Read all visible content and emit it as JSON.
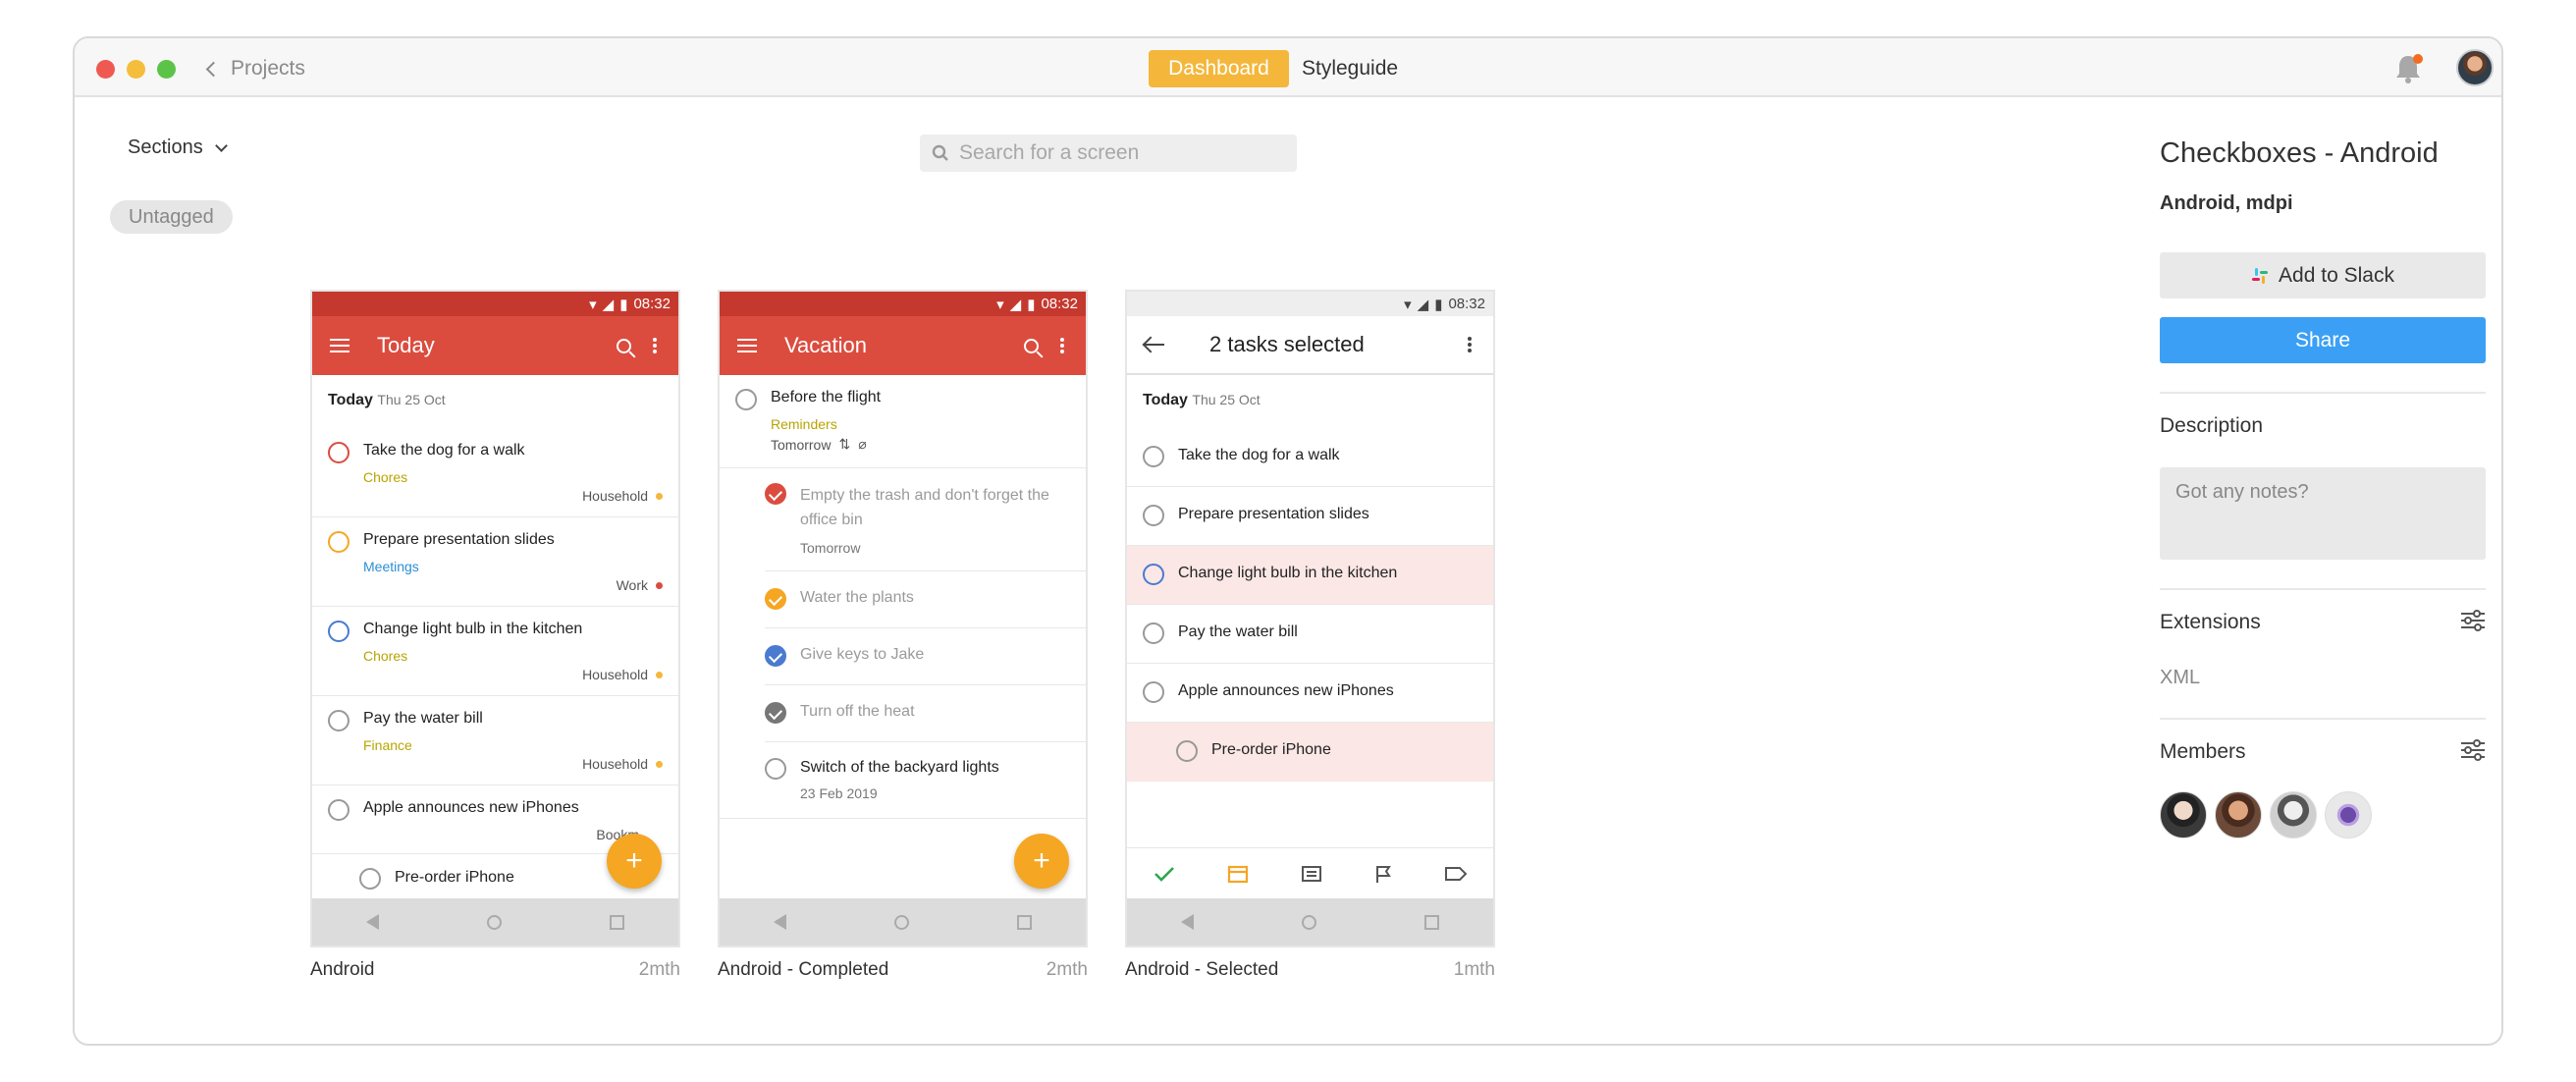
{
  "titlebar": {
    "back_label": "Projects",
    "tabs": [
      "Dashboard",
      "Styleguide"
    ],
    "active_tab": "Dashboard"
  },
  "toolbar": {
    "sections_label": "Sections",
    "untagged_label": "Untagged",
    "search_placeholder": "Search for a screen"
  },
  "screens": [
    {
      "caption": "Android",
      "time": "2mth",
      "status_time": "08:32",
      "title": "Today",
      "day": "Today",
      "date": "Thu 25 Oct",
      "tasks": [
        {
          "title": "Take the dog for a walk",
          "label": "Chores",
          "project": "Household"
        },
        {
          "title": "Prepare presentation slides",
          "label": "Meetings",
          "project": "Work"
        },
        {
          "title": "Change light bulb in the kitchen",
          "label": "Chores",
          "project": "Household"
        },
        {
          "title": "Pay the water bill",
          "label": "Finance",
          "project": "Household"
        },
        {
          "title": "Apple announces new iPhones",
          "label": "",
          "project": "Bookm"
        },
        {
          "title": "Pre-order iPhone",
          "label": "",
          "project": ""
        }
      ],
      "fab": "+"
    },
    {
      "caption": "Android - Completed",
      "time": "2mth",
      "status_time": "08:32",
      "title": "Vacation",
      "tasks": [
        {
          "title": "Before the flight",
          "label": "Reminders",
          "meta": "Tomorrow"
        },
        {
          "title": "Empty the trash and don't forget the office bin",
          "meta": "Tomorrow"
        },
        {
          "title": "Water the plants"
        },
        {
          "title": "Give keys to Jake"
        },
        {
          "title": "Turn off the heat"
        },
        {
          "title": "Switch of the backyard lights",
          "meta": "23 Feb 2019"
        }
      ],
      "fab": "+"
    },
    {
      "caption": "Android - Selected",
      "time": "1mth",
      "status_time": "08:32",
      "title": "2 tasks selected",
      "day": "Today",
      "date": "Thu 25 Oct",
      "tasks": [
        {
          "title": "Take the dog for a walk"
        },
        {
          "title": "Prepare presentation slides"
        },
        {
          "title": "Change light bulb in the kitchen"
        },
        {
          "title": "Pay the water bill"
        },
        {
          "title": "Apple announces new iPhones"
        },
        {
          "title": "Pre-order iPhone"
        }
      ]
    }
  ],
  "panel": {
    "title": "Checkboxes - Android",
    "subtitle": "Android, mdpi",
    "slack_label": "Add to Slack",
    "share_label": "Share",
    "description_label": "Description",
    "notes_placeholder": "Got any notes?",
    "extensions_label": "Extensions",
    "extension_value": "XML",
    "members_label": "Members"
  },
  "colors": {
    "accent": "#f4b73b",
    "todoist_red": "#db4c3f",
    "share_blue": "#3ba0f5",
    "fab_orange": "#f5a623"
  }
}
